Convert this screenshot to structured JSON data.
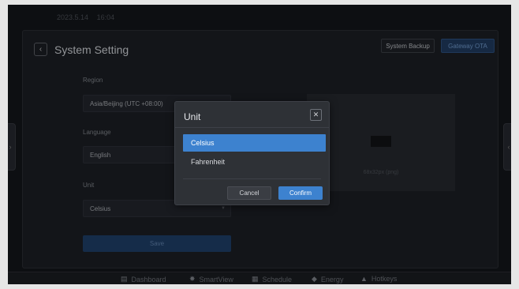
{
  "status_bar": {
    "date": "2023.5.14",
    "time": "16:04"
  },
  "header": {
    "title": "System Setting",
    "system_backup_label": "System Backup",
    "gateway_ota_label": "Gateway OTA"
  },
  "form": {
    "region": {
      "label": "Region",
      "value": "Asia/Beijing (UTC +08:00)"
    },
    "language": {
      "label": "Language",
      "value": "English"
    },
    "unit": {
      "label": "Unit",
      "value": "Celsius"
    },
    "save_label": "Save"
  },
  "logo_upload": {
    "hint": "68x32px (png)"
  },
  "modal": {
    "title": "Unit",
    "options": [
      {
        "label": "Celsius",
        "selected": true
      },
      {
        "label": "Fahrenheit",
        "selected": false
      }
    ],
    "cancel_label": "Cancel",
    "confirm_label": "Confirm"
  },
  "bottom_nav": {
    "items": [
      {
        "label": "Dashboard",
        "icon": "dashboard-icon"
      },
      {
        "label": "SmartView",
        "icon": "smartview-icon"
      },
      {
        "label": "Schedule",
        "icon": "schedule-icon"
      },
      {
        "label": "Energy",
        "icon": "energy-icon"
      },
      {
        "label": "Hotkeys",
        "icon": "hotkeys-icon"
      }
    ]
  },
  "colors": {
    "accent": "#3d82cf",
    "background": "#131519",
    "panel": "#1b1e23",
    "modal": "#2e3136"
  }
}
